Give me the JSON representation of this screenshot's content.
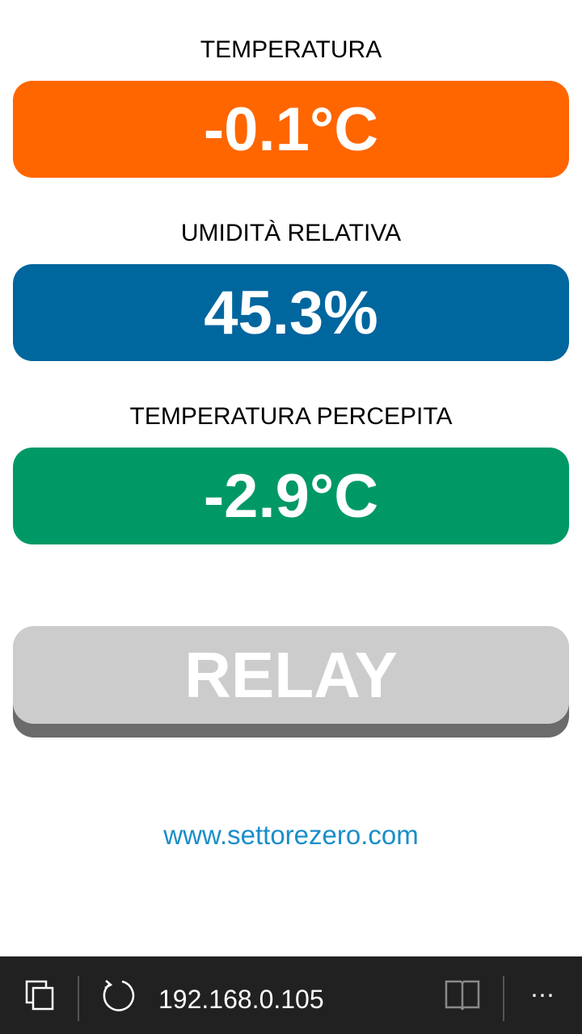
{
  "readings": {
    "temperature": {
      "label": "TEMPERATURA",
      "value": "-0.1°C",
      "color": "#ff6600"
    },
    "humidity": {
      "label": "UMIDITÀ RELATIVA",
      "value": "45.3%",
      "color": "#00669e"
    },
    "feels_like": {
      "label": "TEMPERATURA PERCEPITA",
      "value": "-2.9°C",
      "color": "#009966"
    }
  },
  "relay": {
    "label": "RELAY",
    "color": "#cccccc",
    "shadow_color": "#6b6b6b"
  },
  "footer_link": {
    "text": "www.settorezero.com",
    "color": "#1a8ec9"
  },
  "browser_bar": {
    "url": "192.168.0.105",
    "icons": [
      "tabs-icon",
      "refresh-icon",
      "reading-view-icon",
      "more-icon"
    ],
    "more_label": "⋯"
  }
}
